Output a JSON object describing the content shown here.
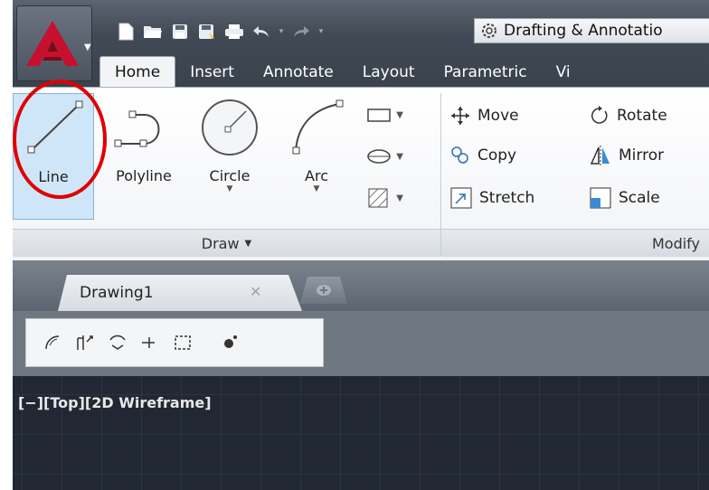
{
  "quick_access": {
    "icons": [
      "new-icon",
      "open-icon",
      "save-icon",
      "save-as-icon",
      "plot-icon",
      "undo-icon",
      "redo-icon"
    ],
    "workspace_label": "Drafting & Annotatio"
  },
  "ribbon_tabs": [
    "Home",
    "Insert",
    "Annotate",
    "Layout",
    "Parametric",
    "Vi"
  ],
  "active_tab": "Home",
  "draw_panel": {
    "tools": [
      "Line",
      "Polyline",
      "Circle",
      "Arc"
    ],
    "title": "Draw"
  },
  "modify_panel": {
    "items": [
      "Move",
      "Rotate",
      "Copy",
      "Mirror",
      "Stretch",
      "Scale"
    ],
    "title": "Modify"
  },
  "file_tabs": [
    "Drawing1"
  ],
  "viewport_label": "[−][Top][2D Wireframe]",
  "colors": {
    "highlight": "#e00000",
    "line_tool_bg": "#cfe6f8",
    "viewport_bg": "#222833",
    "logo_red": "#c8102e"
  }
}
